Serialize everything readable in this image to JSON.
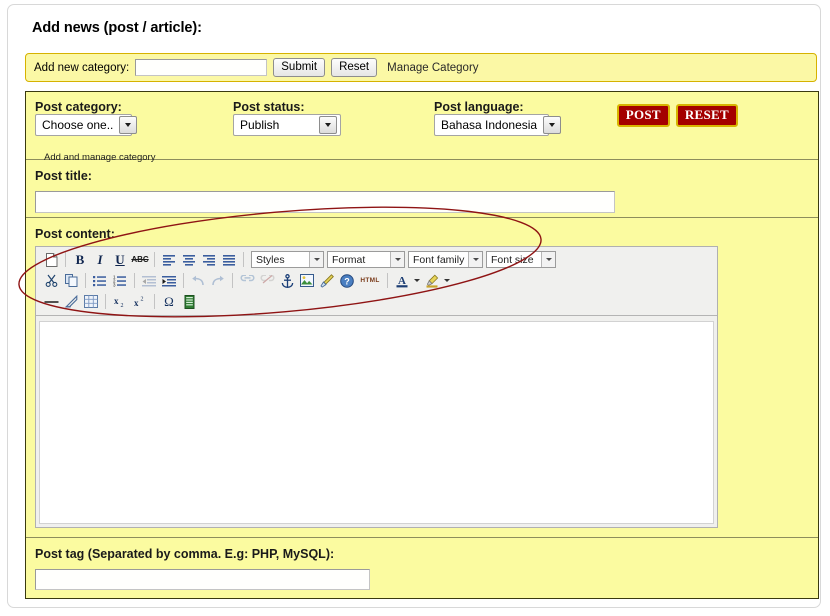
{
  "page": {
    "title": "Add news (post / article):"
  },
  "category_strip": {
    "label": "Add new category:",
    "input_value": "",
    "input_placeholder": "",
    "submit_label": "Submit",
    "reset_label": "Reset",
    "manage_link": "Manage Category"
  },
  "meta": {
    "category": {
      "label": "Post category:",
      "selected": "Choose one..",
      "options": [
        "Choose one.."
      ],
      "sublink": "Add and manage category"
    },
    "status": {
      "label": "Post status:",
      "selected": "Publish",
      "options": [
        "Publish"
      ]
    },
    "language": {
      "label": "Post language:",
      "selected": "Bahasa Indonesia",
      "options": [
        "Bahasa Indonesia"
      ]
    },
    "post_button": "POST",
    "reset_button": "RESET"
  },
  "title_section": {
    "label": "Post title:",
    "value": "",
    "placeholder": ""
  },
  "content_section": {
    "label": "Post content:",
    "body_text": "",
    "editor": {
      "dropdowns": [
        {
          "name": "styles",
          "value": "Styles"
        },
        {
          "name": "format",
          "value": "Format"
        },
        {
          "name": "fontfamily",
          "value": "Font family"
        },
        {
          "name": "fontsize",
          "value": "Font size"
        }
      ],
      "row1_icons": [
        "new-document-icon",
        "separator",
        "bold-icon",
        "italic-icon",
        "underline-icon",
        "strikethrough-icon",
        "separator",
        "align-left-icon",
        "align-center-icon",
        "align-right-icon",
        "align-justify-icon",
        "separator"
      ],
      "row2_icons": [
        "cut-icon",
        "copy-icon",
        "separator",
        "bullet-list-icon",
        "numbered-list-icon",
        "separator",
        "outdent-icon",
        "indent-icon",
        "separator",
        "undo-icon",
        "redo-icon",
        "separator",
        "link-icon",
        "unlink-icon",
        "anchor-icon",
        "insert-image-icon",
        "cleanup-icon",
        "help-icon",
        "html-source-icon",
        "separator",
        "text-color-icon",
        "text-color-dropdown-icon",
        "background-color-icon",
        "background-color-dropdown-icon"
      ],
      "row3_icons": [
        "horizontal-rule-icon",
        "remove-format-icon",
        "toggle-guidelines-icon",
        "separator",
        "subscript-icon",
        "superscript-icon",
        "separator",
        "special-character-icon",
        "insert-media-icon"
      ],
      "html_button_label": "HTML",
      "strikethrough_label": "ABC",
      "subscript_label": "x",
      "superscript_label": "x",
      "special_char_label": "Ω",
      "horizontal_rule_label": "—",
      "text_color_label": "A"
    }
  },
  "tag_section": {
    "label": "Post tag (Separated by comma. E.g: PHP, MySQL):",
    "value": "",
    "placeholder": ""
  },
  "annotation": {
    "shape": "ellipse",
    "color": "#8f1414",
    "target": "post-content-editor-toolbar"
  },
  "colors": {
    "panel_yellow": "#fbfba0",
    "strip_yellow": "#fbf8a5",
    "strip_border": "#d6b200",
    "panel_border": "#3a3a10",
    "action_red": "#a40000",
    "action_gold_border": "#d8b400",
    "annotation_red": "#8f1414"
  }
}
